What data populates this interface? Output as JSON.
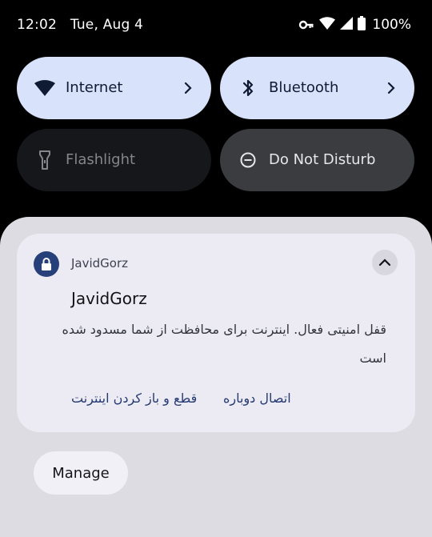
{
  "status_bar": {
    "time": "12:02",
    "date": "Tue, Aug 4",
    "battery": "100%",
    "icons": [
      "vpn-key-icon",
      "wifi-icon",
      "cell-signal-icon",
      "battery-icon"
    ]
  },
  "quick_settings": {
    "internet": {
      "label": "Internet",
      "state": "on"
    },
    "bluetooth": {
      "label": "Bluetooth",
      "state": "on"
    },
    "flashlight": {
      "label": "Flashlight",
      "state": "off"
    },
    "dnd": {
      "label": "Do Not Disturb",
      "state": "off"
    }
  },
  "notification": {
    "app": "JavidGorz",
    "title": "JavidGorz",
    "body": "قفل امنیتی فعال. اینترنت برای محافظت از شما مسدود شده است",
    "actions": {
      "reconnect": "اتصال دوباره",
      "disconnect": "قطع و باز کردن اینترنت"
    }
  },
  "manage": {
    "label": "Manage"
  },
  "colors": {
    "active_tile": "#d8e3fb",
    "shade": "#dddce3",
    "card": "#ecebf3",
    "accent": "#27407a",
    "action_text": "#253a73"
  }
}
